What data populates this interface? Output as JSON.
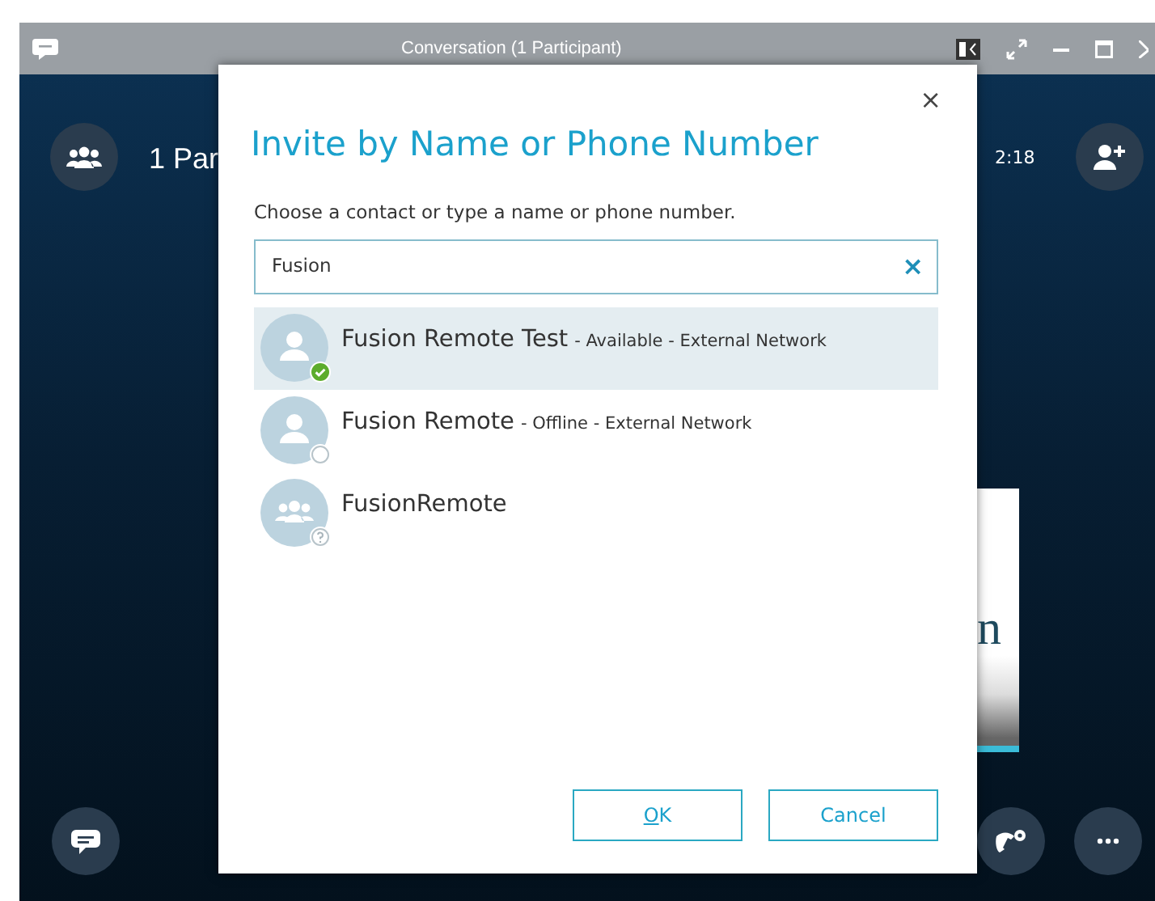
{
  "window": {
    "title": "Conversation (1 Participant)"
  },
  "header": {
    "participants": "1 Par",
    "timer": "2:18"
  },
  "stage": {
    "slide_text": "n"
  },
  "dialog": {
    "close": "×",
    "title": "Invite by Name or Phone Number",
    "prompt": "Choose a contact or type a name or phone number.",
    "search": {
      "value": "Fusion",
      "clear": "×"
    },
    "results": [
      {
        "kind": "person",
        "name": "Fusion Remote Test",
        "detail": "- Available - External Network",
        "presence": {
          "kind": "available"
        },
        "selected": true
      },
      {
        "kind": "person",
        "name": "Fusion Remote",
        "detail": "- Offline - External Network",
        "presence": {
          "kind": "offline"
        },
        "selected": false
      },
      {
        "kind": "group",
        "name": "FusionRemote",
        "presence": {
          "kind": "unknown"
        },
        "selected": false
      }
    ],
    "buttons": [
      {
        "label": "OK",
        "underline_first": true
      },
      {
        "label": "Cancel"
      }
    ]
  }
}
